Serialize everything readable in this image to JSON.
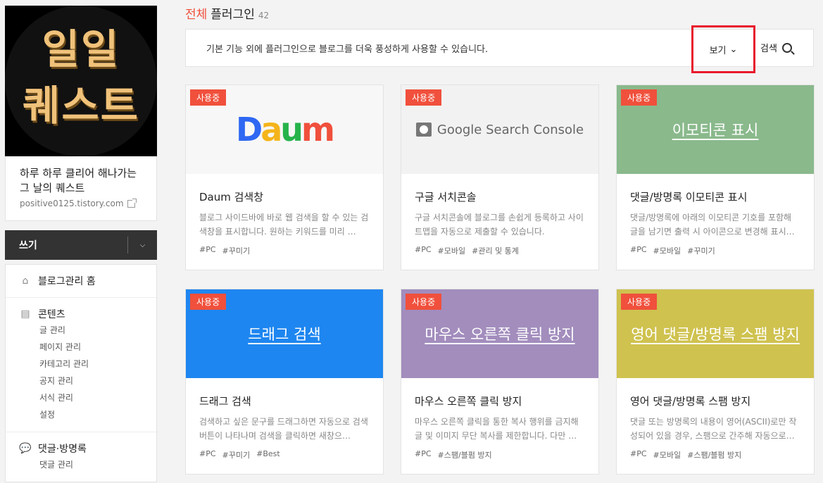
{
  "sidebar": {
    "blog_logo_lines": [
      "일일",
      "퀘스트"
    ],
    "blog_name": "하루 하루 클리어 해나가는 그 날의 퀘스트",
    "blog_url": "positive0125.tistory.com",
    "write_label": "쓰기",
    "menu": [
      {
        "label": "블로그관리 홈",
        "icon": "home-icon",
        "subs": []
      },
      {
        "label": "콘텐츠",
        "icon": "document-icon",
        "subs": [
          "글 관리",
          "페이지 관리",
          "카테고리 관리",
          "공지 관리",
          "서식 관리",
          "설정"
        ]
      },
      {
        "label": "댓글·방명록",
        "icon": "comment-icon",
        "subs": [
          "댓글 관리"
        ]
      }
    ]
  },
  "header": {
    "title_highlight": "전체",
    "title": "플러그인",
    "count": "42",
    "description": "기본 기능 외에 플러그인으로 블로그를 더욱 풍성하게 사용할 수 있습니다.",
    "view_label": "보기",
    "search_label": "검색"
  },
  "colors": {
    "accent": "#f0503c",
    "highlight_border": "#e8192c"
  },
  "cards": [
    {
      "badge": "사용중",
      "image_text": "",
      "image_kind": "daum",
      "image_bg": "#f7f7f7",
      "title": "Daum 검색창",
      "desc": "블로그 사이드바에 바로 웹 검색을 할 수 있는 검색창을 표시합니다. 원하는 키워드를 미리 …",
      "tags": [
        "#PC",
        "#꾸미기"
      ]
    },
    {
      "badge": "사용중",
      "image_text": "Google Search Console",
      "image_kind": "gsc",
      "image_bg": "#f2f2f2",
      "title": "구글 서치콘솔",
      "desc": "구글 서치콘솔에 블로그를 손쉽게 등록하고 사이트맵을 자동으로 제출할 수 있습니다.",
      "tags": [
        "#PC",
        "#모바일",
        "#관리 및 통계"
      ]
    },
    {
      "badge": "사용중",
      "image_text": "이모티콘 표시",
      "image_kind": "text",
      "image_bg": "#8ab98c",
      "title": "댓글/방명록 이모티콘 표시",
      "desc": "댓글/방명록에 아래의 이모티콘 기호를 포함해 글을 남기면 출력 시 아이콘으로 변경해 표시…",
      "tags": [
        "#PC",
        "#모바일",
        "#꾸미기"
      ]
    },
    {
      "badge": "사용중",
      "image_text": "드래그 검색",
      "image_kind": "text",
      "image_bg": "#1e86f0",
      "title": "드래그 검색",
      "desc": "검색하고 싶은 문구를 드래그하면 자동으로 검색 버튼이 나타나며 검색을 클릭하면 새창으…",
      "tags": [
        "#PC",
        "#꾸미기",
        "#Best"
      ]
    },
    {
      "badge": "사용중",
      "image_text": "마우스 오른쪽 클릭 방지",
      "image_kind": "text",
      "image_bg": "#a28dbd",
      "title": "마우스 오른쪽 클릭 방지",
      "desc": "마우스 오른쪽 클릭을 통한 복사 행위를 금지해 글 및 이미지 무단 복사를 제한합니다. 다만 …",
      "tags": [
        "#PC",
        "#스팸/블펌 방지"
      ]
    },
    {
      "badge": "사용중",
      "image_text": "영어 댓글/방명록 스팸 방지",
      "image_kind": "text",
      "image_bg": "#cfc24f",
      "title": "영어 댓글/방명록 스팸 방지",
      "desc": "댓글 또는 방명록의 내용이 영어(ASCII)로만 작성되어 있을 경우, 스팸으로 간주해 자동으로…",
      "tags": [
        "#PC",
        "#모바일",
        "#스팸/블펌 방지"
      ]
    }
  ]
}
